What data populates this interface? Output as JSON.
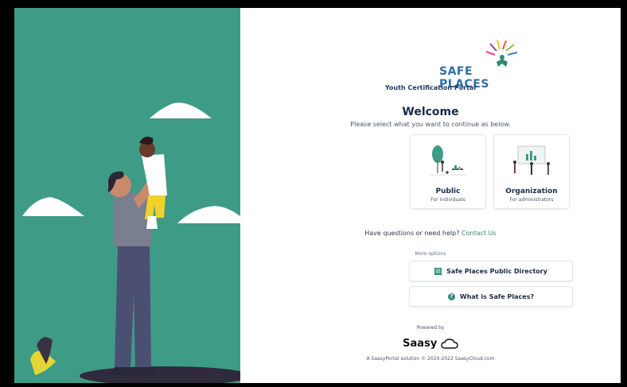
{
  "brand": {
    "name": "SAFE PLACES",
    "subtitle": "Youth Certification Portal"
  },
  "heading": {
    "title": "Welcome",
    "instruction": "Please select what you want to continue as below."
  },
  "options": [
    {
      "title": "Public",
      "subtitle": "For individuals"
    },
    {
      "title": "Organization",
      "subtitle": "For administrators"
    }
  ],
  "help": {
    "text": "Have questions or need help?",
    "link": "Contact Us"
  },
  "more": {
    "label": "More options",
    "buttons": [
      {
        "label": "Safe Places Public Directory",
        "icon": "directory-icon"
      },
      {
        "label": "What is Safe Places?",
        "icon": "question-icon"
      }
    ]
  },
  "footer": {
    "powered_by": "Powered by",
    "vendor": "Saasy",
    "credit": "A SaasyPortal solution © 2020-2022 SaasyCloud.com"
  },
  "colors": {
    "panel": "#3d9b86",
    "accent": "#2c8a73",
    "logo_blue": "#2f6ea4"
  }
}
